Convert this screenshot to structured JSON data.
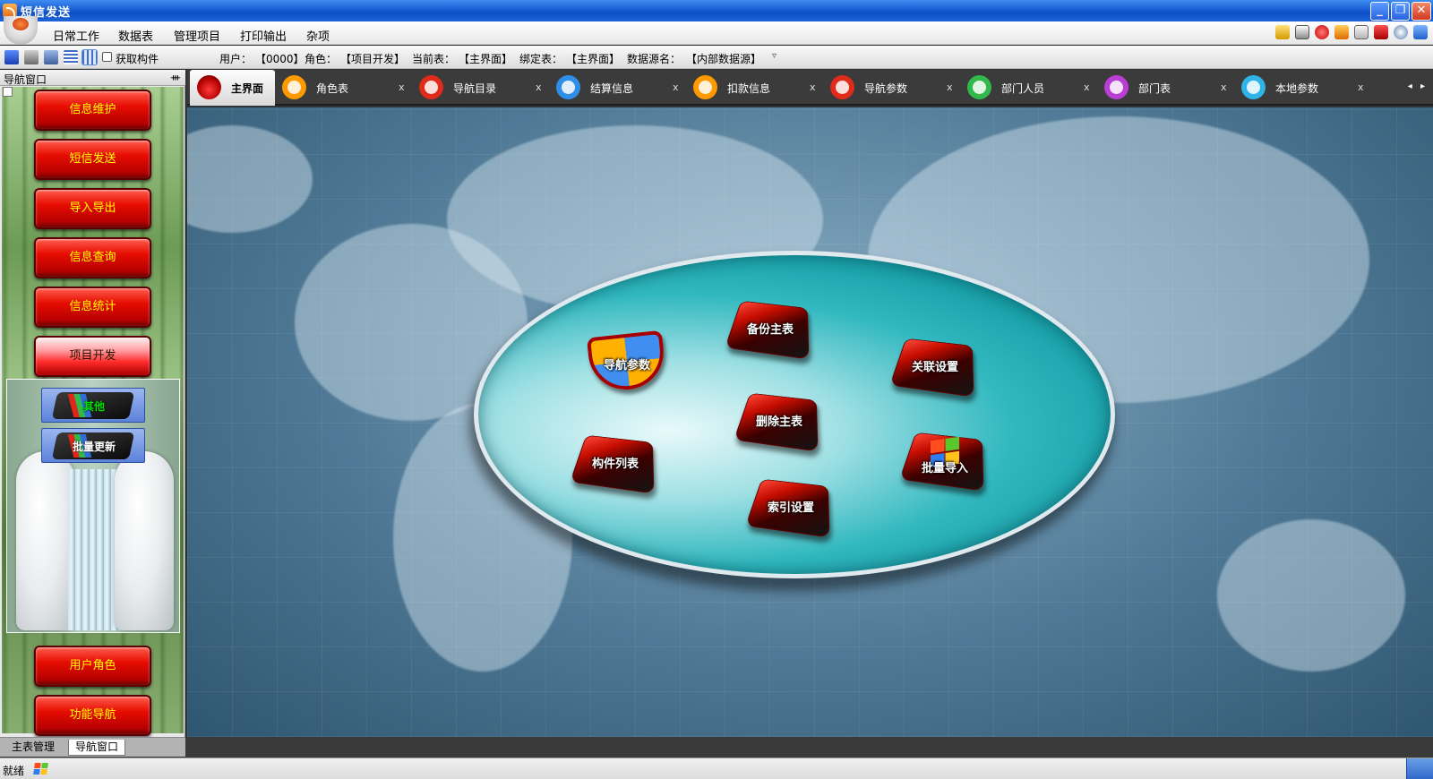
{
  "window": {
    "title": "短信发送",
    "buttons": [
      "_",
      "❐",
      "✕"
    ]
  },
  "menu": {
    "items": [
      "日常工作",
      "数据表",
      "管理项目",
      "打印输出",
      "杂项"
    ]
  },
  "toolbar": {
    "get_component": "获取构件",
    "user_label": "用户：",
    "user_value": "【0000】",
    "role_label": "角色：",
    "role_value": "【项目开发】",
    "current_table_label": "当前表：",
    "current_table_value": "【主界面】",
    "bound_table_label": "绑定表：",
    "bound_table_value": "【主界面】",
    "datasource_label": "数据源名：",
    "datasource_value": "【内部数据源】",
    "dropdown_glyph": "▿"
  },
  "nav": {
    "title": "导航窗口",
    "pin_glyph": "ᚒ",
    "buttons": [
      "信息维护",
      "短信发送",
      "导入导出",
      "信息查询",
      "信息统计",
      "项目开发"
    ],
    "active_index": 5,
    "sub_buttons": [
      "其他",
      "批量更新"
    ],
    "bottom_buttons": [
      "用户角色",
      "功能导航"
    ],
    "tabs": [
      "主表管理",
      "导航窗口"
    ]
  },
  "tabs": [
    {
      "label": "主界面",
      "close": "",
      "color": "#cc0000"
    },
    {
      "label": "角色表",
      "close": "x",
      "color": "#ff9900"
    },
    {
      "label": "导航目录",
      "close": "x",
      "color": "#e02a1a"
    },
    {
      "label": "结算信息",
      "close": "x",
      "color": "#2f8ee8"
    },
    {
      "label": "扣款信息",
      "close": "x",
      "color": "#ff9900"
    },
    {
      "label": "导航参数",
      "close": "x",
      "color": "#e02a1a"
    },
    {
      "label": "部门人员",
      "close": "x",
      "color": "#31b94b"
    },
    {
      "label": "部门表",
      "close": "x",
      "color": "#b93fd4"
    },
    {
      "label": "本地参数",
      "close": "x",
      "color": "#2fb4e8"
    }
  ],
  "tab_nav": "◂ ▸",
  "desktop": {
    "tiles": {
      "nav_params": "导航参数",
      "backup": "备份主表",
      "relation": "关联设置",
      "delete": "删除主表",
      "components": "构件列表",
      "batch_import": "批量导入",
      "index": "索引设置"
    }
  },
  "status": {
    "text": "就绪"
  }
}
